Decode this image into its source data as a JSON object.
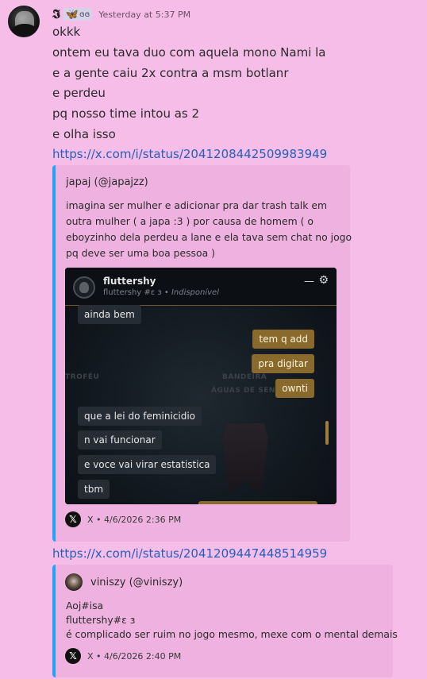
{
  "message": {
    "username": "𝕴",
    "tag_text": "ɞɞ",
    "timestamp": "Yesterday at 5:37 PM",
    "lines": [
      "okkk",
      "ontem eu tava duo com aquela mono Nami la",
      "e a gente caiu 2x contra a msm botlanr",
      "e perdeu",
      "pq nosso time intou as 2",
      "e olha isso"
    ],
    "links": [
      "https://x.com/i/status/2041208442509983949",
      "https://x.com/i/status/2041209447448514959"
    ]
  },
  "embed1": {
    "author": "japaj (@japajzz)",
    "description": [
      "imagina ser mulher e adicionar pra dar trash talk em",
      "outra mulher ( a japa :3 ) por causa de homem ( o",
      "eboyzinho dela perdeu a lane e ela tava sem chat no jogo",
      "pq deve ser uma boa pessoa )"
    ],
    "footer": "X • 4/6/2026 2:36 PM",
    "screenshot": {
      "name": "fluttershy",
      "status_tag": "fluttershy #ɛ ɜ",
      "status_text": "Indisponível",
      "min_glyph": "—",
      "gear_glyph": "⚙",
      "watermarks": [
        "TROFÉU",
        "BANDEIRA",
        "ÁGUAS DE SENT"
      ],
      "bubbles": [
        {
          "side": "left",
          "text": "ainda bem"
        },
        {
          "side": "right",
          "text": "tem q add"
        },
        {
          "side": "right",
          "text": "pra digitar"
        },
        {
          "side": "right",
          "text": "ownti"
        },
        {
          "side": "left",
          "text": "que a lei do feminicidio"
        },
        {
          "side": "left",
          "text": "n vai funcionar"
        },
        {
          "side": "left",
          "text": "e voce vai virar estatistica"
        },
        {
          "side": "left",
          "text": "tbm"
        }
      ]
    }
  },
  "embed2": {
    "author": "viniszy (@viniszy)",
    "description": [
      "Aoj#isa",
      "fluttershy#ɛ ɜ",
      "é complicado ser ruim no jogo mesmo, mexe com o mental demais"
    ],
    "footer": "X • 4/6/2026 2:40 PM"
  },
  "icons": {
    "x_glyph": "𝕏",
    "butterfly": "🦋"
  },
  "colors": {
    "background": "#f5bde8",
    "embed_bg": "#efb2e0",
    "embed_accent": "#1ea4ff",
    "link": "#2560b8"
  }
}
